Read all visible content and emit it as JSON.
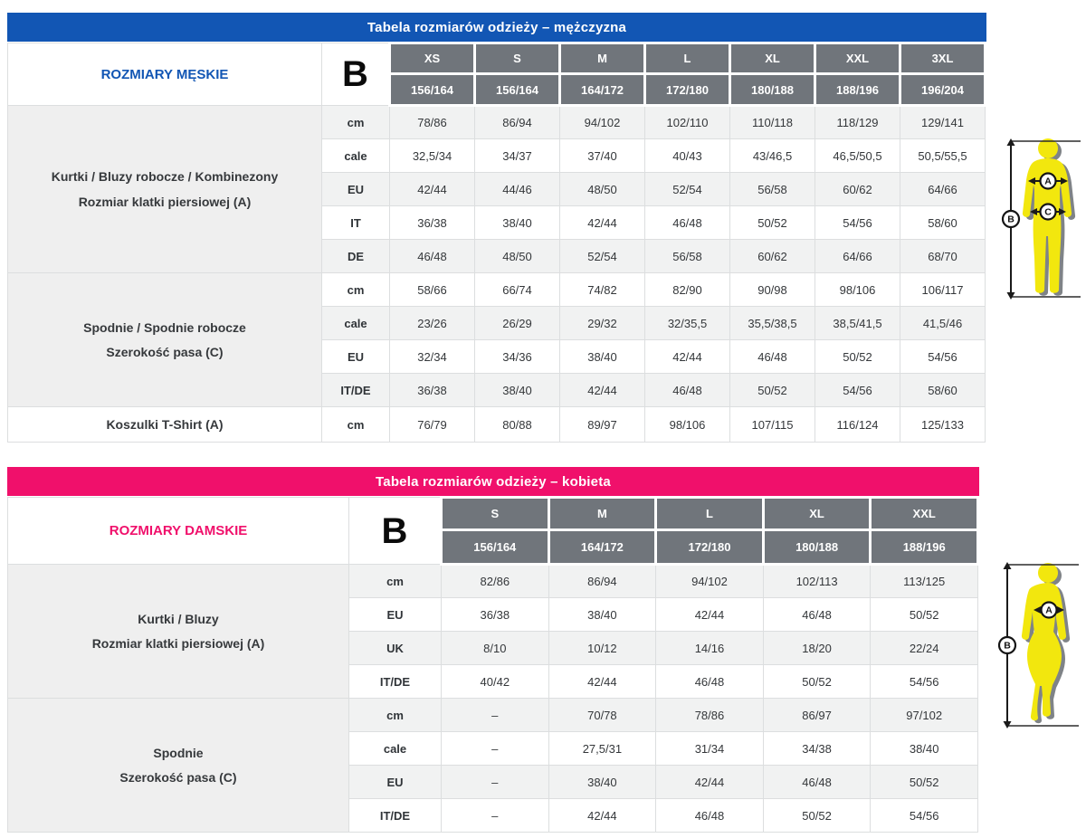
{
  "colors": {
    "men_accent": "#1256b4",
    "women_accent": "#f0106b",
    "header_gray": "#70757b",
    "figure_yellow": "#f2e70e",
    "figure_shadow": "#7f8387"
  },
  "men_table": {
    "title": "Tabela rozmiarów odzieży – mężczyzna",
    "header_label": "ROZMIARY MĘSKIE",
    "b_symbol": "B",
    "sizes": [
      "XS",
      "S",
      "M",
      "L",
      "XL",
      "XXL",
      "3XL"
    ],
    "heights": [
      "156/164",
      "156/164",
      "164/172",
      "172/180",
      "180/188",
      "188/196",
      "196/204"
    ],
    "groups": [
      {
        "label_lines": [
          "Kurtki / Bluzy robocze / Kombinezony",
          "Rozmiar klatki piersiowej (A)"
        ],
        "rows": [
          {
            "unit": "cm",
            "values": [
              "78/86",
              "86/94",
              "94/102",
              "102/110",
              "110/118",
              "118/129",
              "129/141"
            ]
          },
          {
            "unit": "cale",
            "values": [
              "32,5/34",
              "34/37",
              "37/40",
              "40/43",
              "43/46,5",
              "46,5/50,5",
              "50,5/55,5"
            ]
          },
          {
            "unit": "EU",
            "values": [
              "42/44",
              "44/46",
              "48/50",
              "52/54",
              "56/58",
              "60/62",
              "64/66"
            ]
          },
          {
            "unit": "IT",
            "values": [
              "36/38",
              "38/40",
              "42/44",
              "46/48",
              "50/52",
              "54/56",
              "58/60"
            ]
          },
          {
            "unit": "DE",
            "values": [
              "46/48",
              "48/50",
              "52/54",
              "56/58",
              "60/62",
              "64/66",
              "68/70"
            ]
          }
        ]
      },
      {
        "label_lines": [
          "Spodnie / Spodnie robocze",
          "Szerokość pasa (C)"
        ],
        "rows": [
          {
            "unit": "cm",
            "values": [
              "58/66",
              "66/74",
              "74/82",
              "82/90",
              "90/98",
              "98/106",
              "106/117"
            ]
          },
          {
            "unit": "cale",
            "values": [
              "23/26",
              "26/29",
              "29/32",
              "32/35,5",
              "35,5/38,5",
              "38,5/41,5",
              "41,5/46"
            ]
          },
          {
            "unit": "EU",
            "values": [
              "32/34",
              "34/36",
              "38/40",
              "42/44",
              "46/48",
              "50/52",
              "54/56"
            ]
          },
          {
            "unit": "IT/DE",
            "values": [
              "36/38",
              "38/40",
              "42/44",
              "46/48",
              "50/52",
              "54/56",
              "58/60"
            ]
          }
        ]
      },
      {
        "label_lines": [
          "Koszulki T-Shirt (A)"
        ],
        "rows": [
          {
            "unit": "cm",
            "values": [
              "76/79",
              "80/88",
              "89/97",
              "98/106",
              "107/115",
              "116/124",
              "125/133"
            ]
          }
        ]
      }
    ]
  },
  "women_table": {
    "title": "Tabela rozmiarów odzieży – kobieta",
    "header_label": "ROZMIARY DAMSKIE",
    "b_symbol": "B",
    "sizes": [
      "S",
      "M",
      "L",
      "XL",
      "XXL"
    ],
    "heights": [
      "156/164",
      "164/172",
      "172/180",
      "180/188",
      "188/196"
    ],
    "groups": [
      {
        "label_lines": [
          "Kurtki / Bluzy",
          "Rozmiar klatki piersiowej (A)"
        ],
        "rows": [
          {
            "unit": "cm",
            "values": [
              "82/86",
              "86/94",
              "94/102",
              "102/113",
              "113/125"
            ]
          },
          {
            "unit": "EU",
            "values": [
              "36/38",
              "38/40",
              "42/44",
              "46/48",
              "50/52"
            ]
          },
          {
            "unit": "UK",
            "values": [
              "8/10",
              "10/12",
              "14/16",
              "18/20",
              "22/24"
            ]
          },
          {
            "unit": "IT/DE",
            "values": [
              "40/42",
              "42/44",
              "46/48",
              "50/52",
              "54/56"
            ]
          }
        ]
      },
      {
        "label_lines": [
          "Spodnie",
          "Szerokość pasa (C)"
        ],
        "rows": [
          {
            "unit": "cm",
            "values": [
              "–",
              "70/78",
              "78/86",
              "86/97",
              "97/102"
            ]
          },
          {
            "unit": "cale",
            "values": [
              "–",
              "27,5/31",
              "31/34",
              "34/38",
              "38/40"
            ]
          },
          {
            "unit": "EU",
            "values": [
              "–",
              "38/40",
              "42/44",
              "46/48",
              "50/52"
            ]
          },
          {
            "unit": "IT/DE",
            "values": [
              "–",
              "42/44",
              "46/48",
              "50/52",
              "54/56"
            ]
          }
        ]
      }
    ]
  },
  "figures": {
    "male": {
      "chest_label": "A",
      "waist_label": "C",
      "height_label": "B"
    },
    "female": {
      "chest_label": "A",
      "height_label": "B"
    }
  }
}
